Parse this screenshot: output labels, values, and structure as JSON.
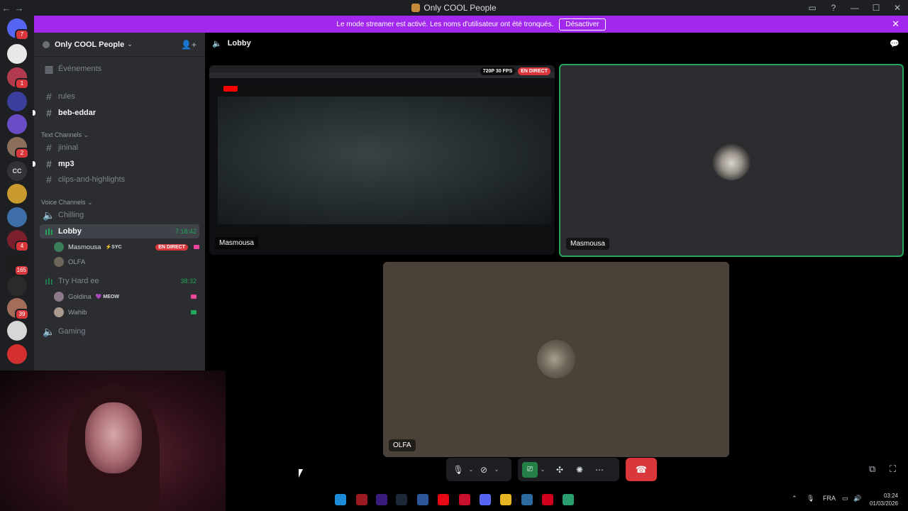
{
  "window": {
    "title": "Only COOL People",
    "nav_back": "←",
    "nav_forward": "→",
    "controls": [
      "—",
      "☐",
      "✕"
    ]
  },
  "banner": {
    "text": "Le mode streamer est activé. Les noms d'utilisateur ont été tronqués.",
    "button": "Désactiver",
    "close": "✕"
  },
  "servers": [
    {
      "name": "discord-home",
      "badge": "7",
      "color": "#5865f2"
    },
    {
      "name": "server-1",
      "badge": "",
      "color": "#e8e8e8"
    },
    {
      "name": "server-2",
      "badge": "1",
      "color": "#b13a4e"
    },
    {
      "name": "server-folder",
      "badge": "",
      "color": "#3a3f9e"
    },
    {
      "name": "server-3",
      "badge": "",
      "color": "#6a4cc7"
    },
    {
      "name": "server-4",
      "badge": "2",
      "color": "#8b6f5a"
    },
    {
      "name": "server-cc",
      "label": "CC",
      "badge": "",
      "color": "#313338"
    },
    {
      "name": "server-5",
      "badge": "",
      "color": "#c99a2e"
    },
    {
      "name": "server-6",
      "badge": "",
      "color": "#3e6fa8"
    },
    {
      "name": "server-7",
      "badge": "4",
      "color": "#7a1f2b"
    },
    {
      "name": "server-8",
      "badge": "165",
      "color": "#1d1d1d"
    },
    {
      "name": "server-9",
      "badge": "",
      "color": "#2a2a2a"
    },
    {
      "name": "server-10",
      "badge": "39",
      "color": "#a36d5a"
    },
    {
      "name": "server-11",
      "badge": "",
      "color": "#d7d7d7"
    },
    {
      "name": "server-12",
      "badge": "",
      "color": "#d32f2f"
    }
  ],
  "guild": {
    "name": "Only COOL People",
    "chevron": "⌄"
  },
  "sidebar": {
    "events": "Événements",
    "channels_top": [
      {
        "name": "rules",
        "unread": false
      },
      {
        "name": "beb-eddar",
        "unread": true
      }
    ],
    "text_category": "Text Channels",
    "text_channels": [
      {
        "name": "jininal",
        "unread": false
      },
      {
        "name": "mp3",
        "unread": true
      },
      {
        "name": "clips-and-highlights",
        "unread": false
      }
    ],
    "voice_category": "Voice Channels",
    "voice": {
      "chilling": "Chilling",
      "lobby": "Lobby",
      "lobby_timer": "7:18:42",
      "lobby_users": [
        {
          "name": "Masmousa",
          "tag": "⚡SYC",
          "live": "EN DIRECT"
        },
        {
          "name": "OLFA",
          "tag": "",
          "live": ""
        }
      ],
      "tryhard": "Try Hard ee",
      "tryhard_timer": "38:32",
      "tryhard_users": [
        {
          "name": "Goldina",
          "tag": "💜 MEOW"
        },
        {
          "name": "Wahib",
          "tag": ""
        }
      ],
      "gaming": "Gaming"
    }
  },
  "call": {
    "channel": "Lobby",
    "stream_quality": "720P 30 FPS",
    "stream_live": "EN DIRECT",
    "stream_name": "Masmousa",
    "tile_masmousa": "Masmousa",
    "tile_olfa": "OLFA"
  },
  "taskbar": {
    "lang": "FRA",
    "time": "03:24",
    "date": "01/03/2026"
  }
}
